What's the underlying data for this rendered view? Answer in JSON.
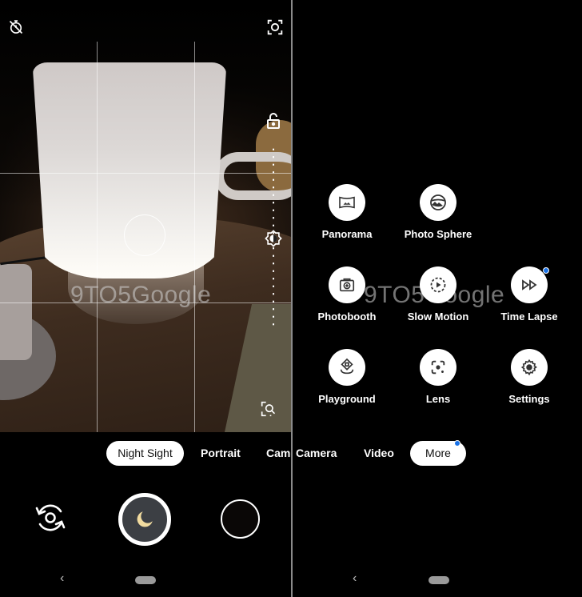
{
  "colors": {
    "accent_dot": "#1a73e8",
    "shutter_fill": "#3c3f44",
    "moon": "#f2dca0",
    "pill_bg": "#ffffff"
  },
  "watermark": "9TO5Google",
  "left": {
    "top_bar": {
      "timer_icon": "timer-off-icon",
      "selfie_icon": "screen-capture-icon"
    },
    "side_controls": {
      "lock_icon": "lock-open-icon",
      "exposure_icon": "brightness-icon",
      "zoom_icon": "zoom-search-icon"
    },
    "modes": [
      "Night Sight",
      "Portrait",
      "Came"
    ],
    "active_mode": "Night Sight",
    "controls": {
      "switch_camera_icon": "switch-camera-icon",
      "shutter_icon": "moon-icon",
      "thumbnail": "gallery-thumbnail"
    }
  },
  "right": {
    "modes": [
      "Camera",
      "Video",
      "More"
    ],
    "active_mode": "More",
    "more_menu": [
      {
        "label": "Panorama",
        "icon": "panorama-icon",
        "badge": false
      },
      {
        "label": "Photo Sphere",
        "icon": "photo-sphere-icon",
        "badge": false
      },
      {
        "label": "Photobooth",
        "icon": "photobooth-icon",
        "badge": false
      },
      {
        "label": "Slow Motion",
        "icon": "slow-motion-icon",
        "badge": false
      },
      {
        "label": "Time Lapse",
        "icon": "time-lapse-icon",
        "badge": true
      },
      {
        "label": "Playground",
        "icon": "playground-icon",
        "badge": false
      },
      {
        "label": "Lens",
        "icon": "lens-icon",
        "badge": false
      },
      {
        "label": "Settings",
        "icon": "settings-icon",
        "badge": false
      }
    ]
  },
  "nav": {
    "back_glyph": "‹"
  }
}
